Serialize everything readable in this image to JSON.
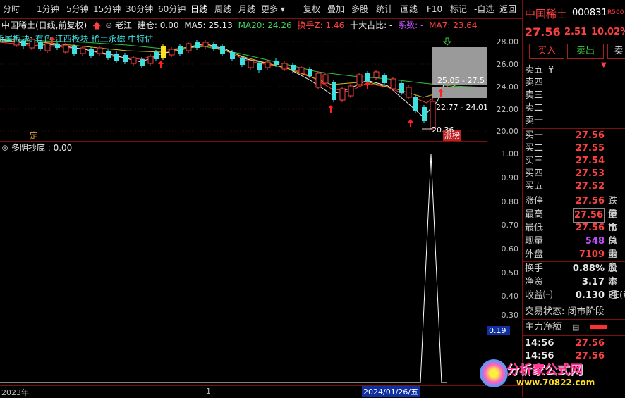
{
  "toolbar": {
    "period_tabs": [
      "分时",
      "1分钟",
      "5分钟",
      "15分钟",
      "30分钟",
      "60分钟",
      "日线",
      "周线",
      "月线",
      "更多 ▾"
    ],
    "actions": [
      "复权",
      "叠加",
      "多股",
      "统计",
      "画线",
      "F10",
      "标记",
      "-自选",
      "返回"
    ]
  },
  "chart": {
    "title": "中国稀土(日线,前复权)",
    "indicator_legend": {
      "laojiang": "老江",
      "jiancang": "建仓: 0.00",
      "ma5": "MA5: 25.13",
      "ma20": "MA20: 24.26",
      "huanshou": "换手Z: 1.46",
      "shida": "十大占比: -",
      "xishu": "系数: -",
      "ma7": "MA7: 23.64"
    },
    "sector_line": "所属板块: 有色 江西板块 稀土永磁 中特估",
    "ding_label": "定",
    "zhangting_label": "涨榜",
    "price_ticks": [
      "28.00",
      "26.00",
      "24.00",
      "22.00",
      "20.00"
    ],
    "annotations": {
      "upper_band": "25.05 - 27.5",
      "lower_band": "22.77 - 24.01",
      "low_mark": "20.36"
    },
    "indicator_title": "多阴抄底 : 0.00",
    "indicator_ticks": [
      "1.00",
      "0.90",
      "0.80",
      "0.70",
      "0.60",
      "0.50",
      "0.40",
      "0.30"
    ],
    "indicator_current": "0.19",
    "bottom_labels": {
      "year": "2023年",
      "month": "1",
      "cursor_date": "2024/01/26/五"
    }
  },
  "panel": {
    "name": "中国稀土",
    "code": "000831",
    "badge": "R500",
    "price": "27.56",
    "change": "2.51",
    "pct": "10.02%",
    "buy_btn": "买入",
    "sell_btn": "卖出",
    "third_btn": "卖",
    "asks": [
      {
        "label": "卖五",
        "price": "",
        "vol": ""
      },
      {
        "label": "卖四",
        "price": "",
        "vol": ""
      },
      {
        "label": "卖三",
        "price": "",
        "vol": ""
      },
      {
        "label": "卖二",
        "price": "",
        "vol": ""
      },
      {
        "label": "卖一",
        "price": "",
        "vol": ""
      }
    ],
    "ask5_extra": "¥",
    "bids": [
      {
        "label": "买一",
        "price": "27.56"
      },
      {
        "label": "买二",
        "price": "27.55"
      },
      {
        "label": "买三",
        "price": "27.54"
      },
      {
        "label": "买四",
        "price": "27.53"
      },
      {
        "label": "买五",
        "price": "27.52"
      }
    ],
    "stats": [
      {
        "label": "涨停",
        "val": "27.56",
        "cls": "red",
        "side": "跌停"
      },
      {
        "label": "最高",
        "val": "27.56",
        "cls": "red",
        "side": "量比"
      },
      {
        "label": "最低",
        "val": "27.56",
        "cls": "red",
        "side": "市值"
      },
      {
        "label": "现量",
        "val": "548",
        "cls": "purple",
        "side": "总量"
      },
      {
        "label": "外盘",
        "val": "7109",
        "cls": "red",
        "side": "内盘"
      }
    ],
    "stats2": [
      {
        "label": "换手",
        "val": "0.88%",
        "side": "股本"
      },
      {
        "label": "净资",
        "val": "3.17",
        "side": "流通"
      },
      {
        "label": "收益㈢",
        "val": "0.130",
        "side": "PE(动"
      }
    ],
    "trade_status": "交易状态: 闭市阶段",
    "main_flow": "主力净额",
    "ticks": [
      {
        "time": "14:56",
        "price": "27.56"
      },
      {
        "time": "14:56",
        "price": "27.56"
      }
    ],
    "watermark": "分析家公式网",
    "watermark_url": "www.70822.com"
  }
}
